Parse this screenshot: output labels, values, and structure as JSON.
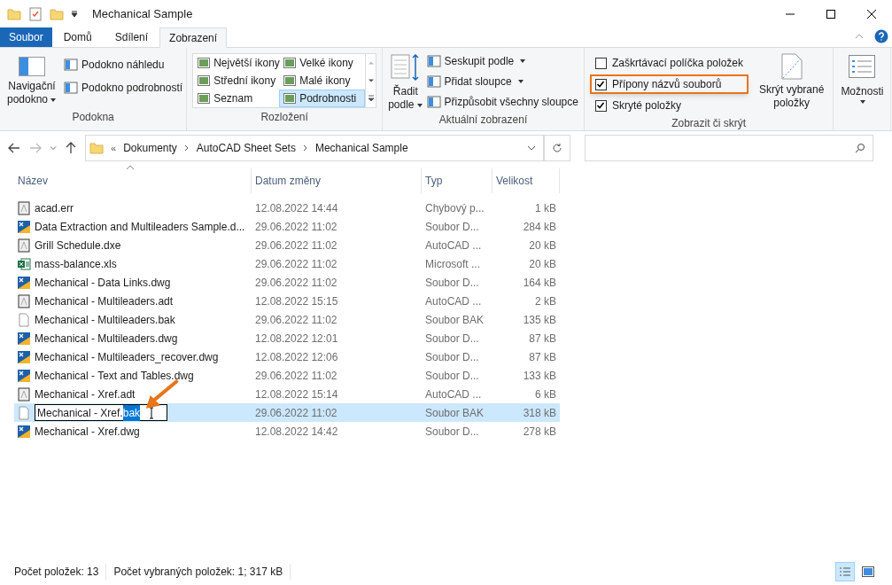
{
  "window": {
    "title": "Mechanical Sample"
  },
  "tabs": [
    {
      "label": "Soubor",
      "kind": "file",
      "selected": false
    },
    {
      "label": "Domů",
      "kind": "tab",
      "selected": false
    },
    {
      "label": "Sdílení",
      "kind": "tab",
      "selected": false
    },
    {
      "label": "Zobrazení",
      "kind": "tab",
      "selected": true
    }
  ],
  "ribbon": {
    "panes": {
      "nav_label": [
        "Navigační",
        "podokno"
      ],
      "items": [
        "Podokno náhledu",
        "Podokno podrobností"
      ],
      "caption": "Podokna"
    },
    "layout": {
      "options": [
        {
          "label": "Největší ikony",
          "selected": false
        },
        {
          "label": "Velké ikony",
          "selected": false
        },
        {
          "label": "Střední ikony",
          "selected": false
        },
        {
          "label": "Malé ikony",
          "selected": false
        },
        {
          "label": "Seznam",
          "selected": false
        },
        {
          "label": "Podrobnosti",
          "selected": true
        }
      ],
      "caption": "Rozložení"
    },
    "current": {
      "sort_label": [
        "Řadit",
        "podle"
      ],
      "items": [
        {
          "label": "Seskupit podle",
          "dropdown": true
        },
        {
          "label": "Přidat sloupce",
          "dropdown": true
        },
        {
          "label": "Přizpůsobit všechny sloupce",
          "dropdown": false
        }
      ],
      "caption": "Aktuální zobrazení"
    },
    "show_hide": {
      "checkboxes": [
        {
          "label": "Zaškrtávací políčka položek",
          "checked": false,
          "highlighted": false
        },
        {
          "label": "Přípony názvů souborů",
          "checked": true,
          "highlighted": true
        },
        {
          "label": "Skryté položky",
          "checked": true,
          "highlighted": false
        }
      ],
      "hide_label": [
        "Skrýt vybrané",
        "položky"
      ],
      "caption": "Zobrazit či skrýt"
    },
    "options_label": "Možnosti"
  },
  "address": {
    "overflow": "«",
    "crumbs": [
      "Dokumenty",
      "AutoCAD Sheet Sets",
      "Mechanical Sample"
    ]
  },
  "table": {
    "columns": [
      "Název",
      "Datum změny",
      "Typ",
      "Velikost"
    ],
    "rows": [
      {
        "name": "acad.err",
        "date": "12.08.2022 14:44",
        "type": "Chybový p...",
        "size": "1 kB",
        "kind": "cad-text",
        "selected": false
      },
      {
        "name": "Data Extraction and Multileaders Sample.d...",
        "date": "29.06.2022 11:02",
        "type": "Soubor D...",
        "size": "284 kB",
        "kind": "dwg",
        "selected": false
      },
      {
        "name": "Grill Schedule.dxe",
        "date": "29.06.2022 11:02",
        "type": "AutoCAD ...",
        "size": "20 kB",
        "kind": "cad-text",
        "selected": false
      },
      {
        "name": "mass-balance.xls",
        "date": "29.06.2022 11:02",
        "type": "Microsoft ...",
        "size": "20 kB",
        "kind": "sheet",
        "selected": false
      },
      {
        "name": "Mechanical - Data Links.dwg",
        "date": "29.06.2022 11:02",
        "type": "Soubor D...",
        "size": "164 kB",
        "kind": "dwg",
        "selected": false
      },
      {
        "name": "Mechanical - Multileaders.adt",
        "date": "12.08.2022 15:15",
        "type": "AutoCAD ...",
        "size": "2 kB",
        "kind": "cad-text",
        "selected": false
      },
      {
        "name": "Mechanical - Multileaders.bak",
        "date": "29.06.2022 11:02",
        "type": "Soubor BAK",
        "size": "135 kB",
        "kind": "blank",
        "selected": false
      },
      {
        "name": "Mechanical - Multileaders.dwg",
        "date": "12.08.2022 12:01",
        "type": "Soubor D...",
        "size": "87 kB",
        "kind": "dwg",
        "selected": false
      },
      {
        "name": "Mechanical - Multileaders_recover.dwg",
        "date": "12.08.2022 12:06",
        "type": "Soubor D...",
        "size": "87 kB",
        "kind": "dwg",
        "selected": false
      },
      {
        "name": "Mechanical - Text and Tables.dwg",
        "date": "29.06.2022 11:02",
        "type": "Soubor D...",
        "size": "133 kB",
        "kind": "dwg",
        "selected": false
      },
      {
        "name": "Mechanical - Xref.adt",
        "date": "12.08.2022 15:14",
        "type": "AutoCAD ...",
        "size": "6 kB",
        "kind": "cad-text",
        "selected": false
      },
      {
        "name": "Mechanical - Xref.",
        "name_selected": "bak",
        "editing": true,
        "date": "29.06.2022 11:02",
        "type": "Soubor BAK",
        "size": "318 kB",
        "kind": "blank",
        "selected": true
      },
      {
        "name": "Mechanical - Xref.dwg",
        "date": "12.08.2022 14:42",
        "type": "Soubor D...",
        "size": "278 kB",
        "kind": "dwg",
        "selected": false
      }
    ]
  },
  "status_bar": {
    "count": "Počet položek: 13",
    "selection": "Počet vybraných položek: 1; 317 kB"
  }
}
